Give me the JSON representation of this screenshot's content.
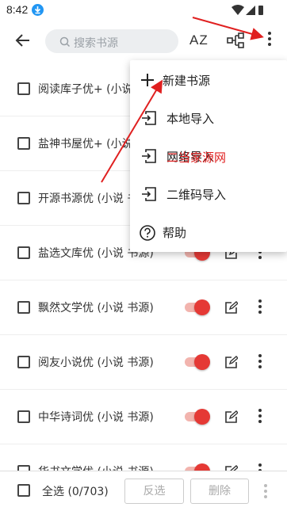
{
  "status": {
    "time": "8:42"
  },
  "search": {
    "placeholder": "搜索书源"
  },
  "toolbar": {
    "sort_label": "AZ"
  },
  "rows": [
    {
      "name": "阅读库子优+ (小说 书源)"
    },
    {
      "name": "盐神书屋优+ (小说 书源)"
    },
    {
      "name": "开源书源优 (小说 书源)"
    },
    {
      "name": "盐选文库优 (小说 书源)"
    },
    {
      "name": "飘然文学优 (小说 书源)"
    },
    {
      "name": "阅友小说优 (小说 书源)"
    },
    {
      "name": "中华诗词优 (小说 书源)"
    },
    {
      "name": "华书文学优 (小说 书源)"
    }
  ],
  "menu": {
    "items": [
      {
        "label": "新建书源"
      },
      {
        "label": "本地导入"
      },
      {
        "label": "网络导入"
      },
      {
        "label": "二维码导入"
      },
      {
        "label": "帮助"
      }
    ]
  },
  "watermark": "二当家源网",
  "bottom": {
    "select_all": "全选 (0/703)",
    "invert": "反选",
    "delete": "删除"
  },
  "colors": {
    "accent": "#e53935",
    "annotation": "#e02020"
  }
}
